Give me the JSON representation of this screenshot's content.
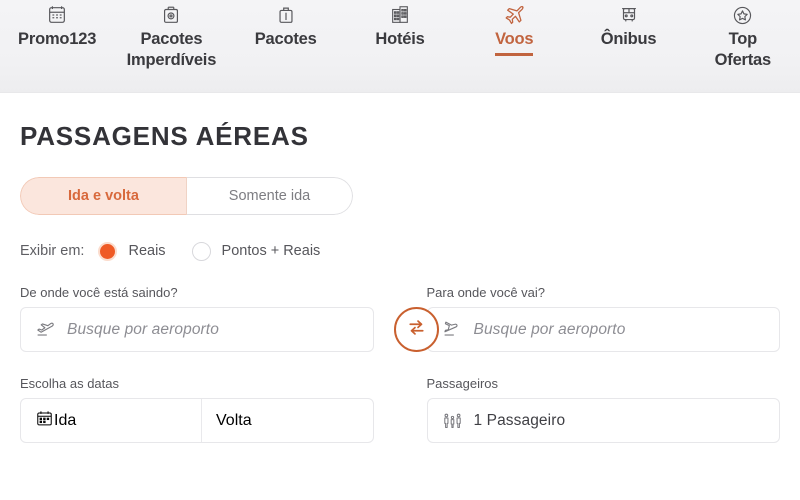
{
  "nav": {
    "items": [
      {
        "label": "Promo123",
        "icon": "calendar-ticket-icon",
        "active": false
      },
      {
        "label": "Pacotes\nImperdíveis",
        "icon": "camera-suitcase-icon",
        "active": false
      },
      {
        "label": "Pacotes",
        "icon": "suitcase-icon",
        "active": false
      },
      {
        "label": "Hotéis",
        "icon": "building-icon",
        "active": false
      },
      {
        "label": "Voos",
        "icon": "airplane-icon",
        "active": true
      },
      {
        "label": "Ônibus",
        "icon": "bus-icon",
        "active": false
      },
      {
        "label": "Top\nOfertas",
        "icon": "star-circle-icon",
        "active": false
      }
    ]
  },
  "main": {
    "page_title": "PASSAGENS AÉREAS",
    "trip_type": {
      "options": [
        "Ida e volta",
        "Somente ida"
      ],
      "selected": "Ida e volta"
    },
    "display_in": {
      "prefix": "Exibir em:",
      "options": [
        "Reais",
        "Pontos + Reais"
      ],
      "selected": "Reais"
    },
    "origin": {
      "label": "De onde você está saindo?",
      "placeholder": "Busque por aeroporto",
      "value": "",
      "icon": "plane-takeoff-icon"
    },
    "destination": {
      "label": "Para onde você vai?",
      "placeholder": "Busque por aeroporto",
      "value": "",
      "icon": "plane-landing-icon"
    },
    "swap": {
      "icon": "swap-arrows-icon"
    },
    "dates": {
      "label": "Escolha as datas",
      "depart_placeholder": "Ida",
      "return_placeholder": "Volta",
      "icon": "calendar-icon"
    },
    "passengers": {
      "label": "Passageiros",
      "value": "1 Passageiro",
      "icon": "passengers-icon"
    }
  },
  "colors": {
    "accent_muted": "#c1643f",
    "accent_bright": "#ef5a25",
    "toggle_bg": "#fbe6dd",
    "nav_bg": "#f1f1f3",
    "text_dark": "#333338",
    "text_muted": "#8d8d93"
  }
}
